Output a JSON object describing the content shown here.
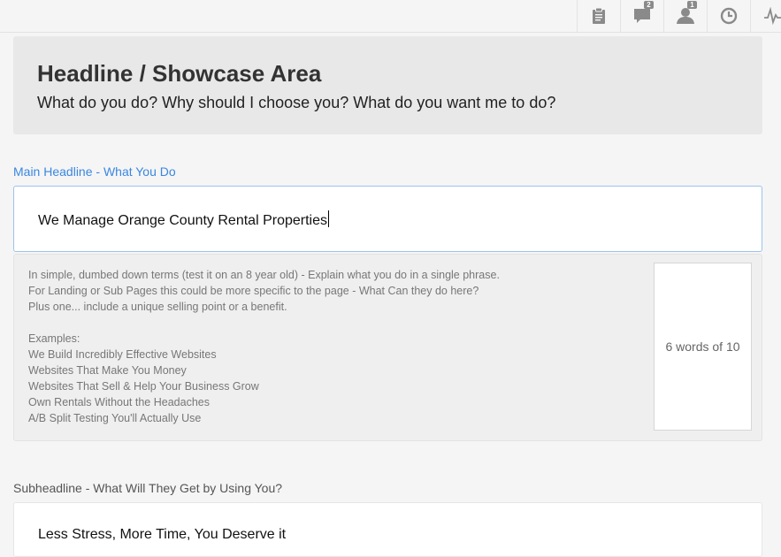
{
  "toolbar": {
    "items": [
      {
        "icon": "clipboard-icon"
      },
      {
        "icon": "comment-icon",
        "badge": "2"
      },
      {
        "icon": "user-icon",
        "badge": "1"
      },
      {
        "icon": "clock-icon"
      },
      {
        "icon": "activity-icon"
      }
    ]
  },
  "showcase": {
    "title": "Headline / Showcase Area",
    "subtitle": "What do you do? Why should I choose you? What do you want me to do?"
  },
  "main_headline": {
    "label": "Main Headline - What You Do",
    "value": "We Manage Orange County Rental Properties",
    "help": {
      "lines": [
        "In simple, dumbed down terms (test it on an 8 year old) - Explain what you do in a single phrase.",
        "For Landing or Sub Pages this could be more specific to the page - What Can they do here?",
        "Plus one... include a unique selling point or a benefit.",
        "",
        "Examples:",
        "We Build Incredibly Effective Websites",
        "Websites That Make You Money",
        "Websites That Sell & Help Your Business Grow",
        "Own Rentals Without the Headaches",
        "A/B Split Testing You'll Actually Use"
      ]
    },
    "word_count": "6 words of 10"
  },
  "subheadline": {
    "label": "Subheadline - What Will They Get by Using You?",
    "value": "Less Stress, More Time, You Deserve it"
  },
  "colors": {
    "accent_label": "#3a87e0",
    "focus_border": "#9cc3ec",
    "panel_bg": "#e8e8e8"
  }
}
